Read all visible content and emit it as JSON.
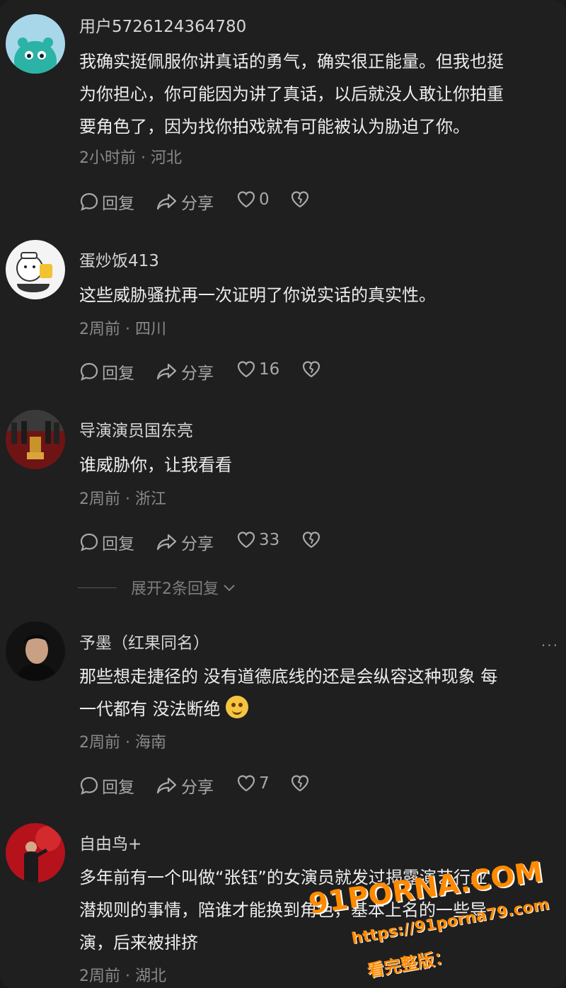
{
  "comments": [
    {
      "username": "用户5726124364780",
      "lines": [
        "我确实挺佩服你讲真话的勇气，确实很正能量。但我也挺",
        "为你担心，你可能因为讲了真话，以后就没人敢让你拍重",
        "要角色了，因为找你拍戏就有可能被认为胁迫了你。"
      ],
      "time": "2小时前",
      "location": "河北",
      "reply_label": "回复",
      "share_label": "分享",
      "likes": "0"
    },
    {
      "username": "蛋炒饭413",
      "lines": [
        "这些威胁骚扰再一次证明了你说实话的真实性。"
      ],
      "time": "2周前",
      "location": "四川",
      "reply_label": "回复",
      "share_label": "分享",
      "likes": "16"
    },
    {
      "username": "导演演员国东亮",
      "lines": [
        "谁威胁你，让我看看"
      ],
      "time": "2周前",
      "location": "浙江",
      "reply_label": "回复",
      "share_label": "分享",
      "likes": "33",
      "expand_label": "展开2条回复"
    },
    {
      "username": "予墨（红果同名）",
      "lines": [
        "那些想走捷径的 没有道德底线的还是会纵容这种现象 每",
        "一代都有 没法断绝"
      ],
      "time": "2周前",
      "location": "海南",
      "reply_label": "回复",
      "share_label": "分享",
      "likes": "7",
      "more": "···"
    },
    {
      "username": "自由鸟+",
      "lines": [
        "多年前有一个叫做“张钰”的女演员就发过揭露演艺行业",
        "潜规则的事情，陪谁才能换到角色，基本上名的一些导",
        "演，后来被排挤"
      ],
      "time": "2周前",
      "location": "湖北"
    }
  ],
  "watermark": {
    "brand": "91PORNA.COM",
    "url": "https://91porna79.com",
    "note": "看完整版："
  },
  "colors": {
    "background": "#1f1f1f",
    "text": "#ededed",
    "meta": "#8a8a8a",
    "watermark": "#ff8a00"
  }
}
